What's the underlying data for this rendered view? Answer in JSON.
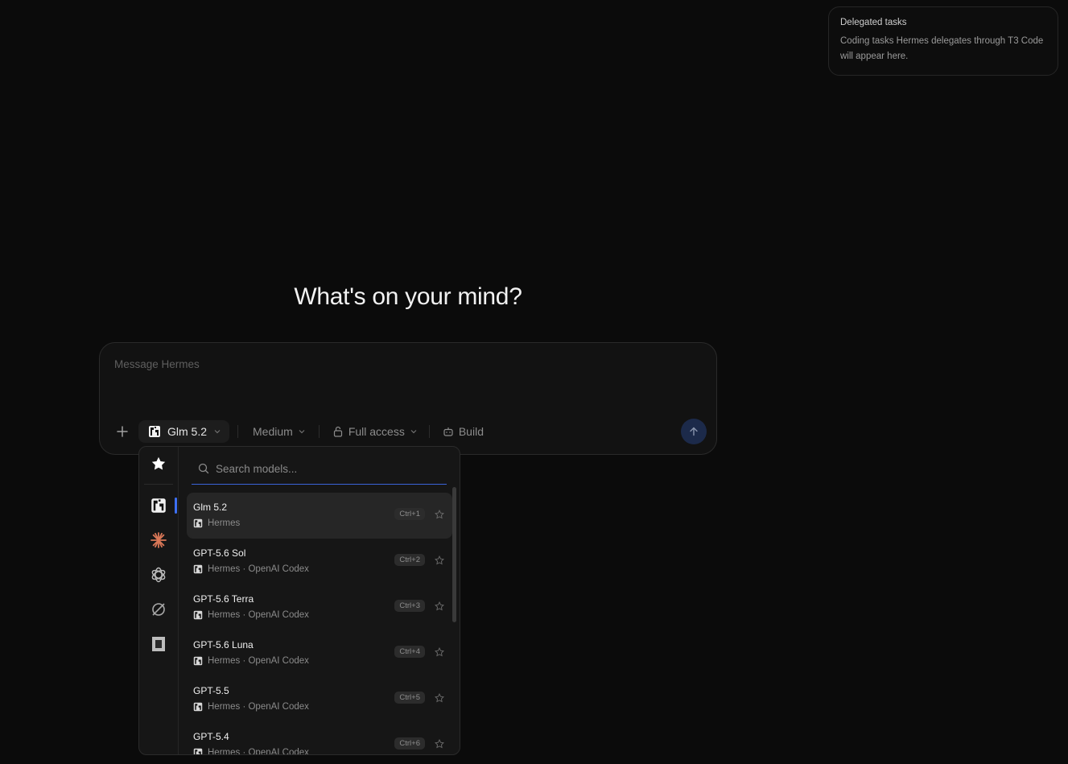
{
  "delegated": {
    "title": "Delegated tasks",
    "description": "Coding tasks Hermes delegates through T3 Code will appear here."
  },
  "heading": "What's on your mind?",
  "composer": {
    "placeholder": "Message Hermes",
    "model_label": "Glm 5.2",
    "effort_label": "Medium",
    "access_label": "Full access",
    "mode_label": "Build"
  },
  "picker": {
    "search_placeholder": "Search models...",
    "rail_icons": [
      "star-icon",
      "hermes-icon",
      "anthropic-icon",
      "openai-icon",
      "cursor-icon",
      "opencode-icon"
    ],
    "models": [
      {
        "name": "Glm 5.2",
        "provider": "Hermes",
        "shortcut": "Ctrl+1"
      },
      {
        "name": "GPT-5.6 Sol",
        "provider": "Hermes · OpenAI Codex",
        "shortcut": "Ctrl+2"
      },
      {
        "name": "GPT-5.6 Terra",
        "provider": "Hermes · OpenAI Codex",
        "shortcut": "Ctrl+3"
      },
      {
        "name": "GPT-5.6 Luna",
        "provider": "Hermes · OpenAI Codex",
        "shortcut": "Ctrl+4"
      },
      {
        "name": "GPT-5.5",
        "provider": "Hermes · OpenAI Codex",
        "shortcut": "Ctrl+5"
      },
      {
        "name": "GPT-5.4",
        "provider": "Hermes · OpenAI Codex",
        "shortcut": "Ctrl+6"
      }
    ]
  },
  "colors": {
    "accent": "#3d6ff2",
    "anthropic": "#d97757",
    "send_bg": "#1c2a4a"
  }
}
